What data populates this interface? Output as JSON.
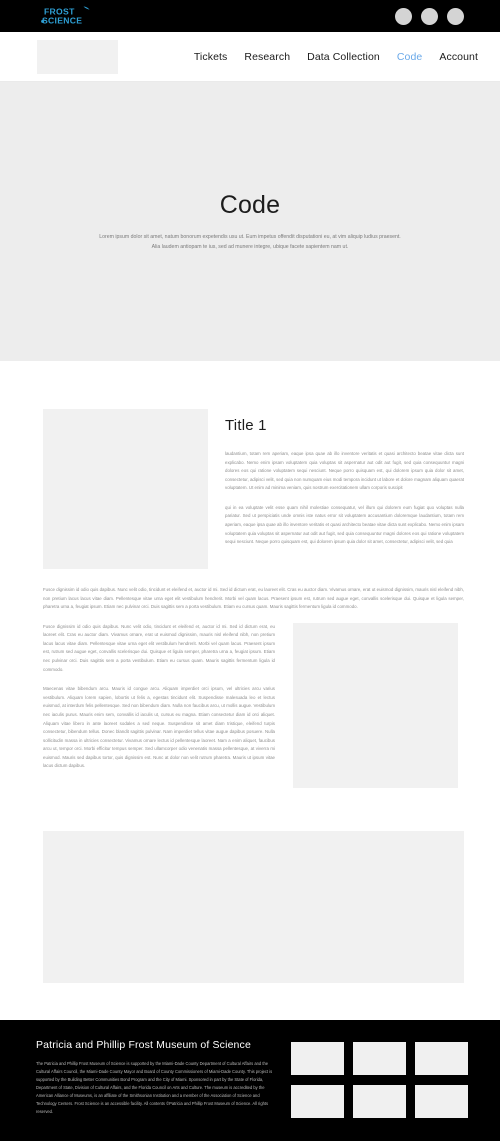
{
  "topbar": {
    "logo_text_line1": "FROST",
    "logo_text_line2": "SCIENCE",
    "logo_accent_color": "#2e9fd4",
    "social_icons": [
      "social-circle-1",
      "social-circle-2",
      "social-circle-3"
    ]
  },
  "nav": {
    "logo_placeholder": "nav-logo-placeholder",
    "links": [
      {
        "label": "Tickets",
        "active": false
      },
      {
        "label": "Research",
        "active": false
      },
      {
        "label": "Data Collection",
        "active": false
      },
      {
        "label": "Code",
        "active": true
      },
      {
        "label": "Account",
        "active": false
      }
    ],
    "active_color": "#6aa9e9"
  },
  "hero": {
    "title": "Code",
    "subtitle": "Lorem ipsum dolor sit amet, natum bonorum expetendis usu ut. Eum impetus offendit disputationi eu, at vim aliquip ludius praesent. Alia laudem antiopam te ius, sed ad munere integre, ubique facete sapientem nam ut.",
    "background": "#ededed"
  },
  "main": {
    "section_title": "Title 1",
    "paragraph_1": "laudantium, totam rem aperiam, eaque ipsa quae ab illo inventore veritatis et quasi architecto beatae vitae dicta sunt explicabo. Nemo enim ipsam voluptatem quia voluptas sit aspernatur aut odit aut fugit, sed quia consequuntur magni dolores eos qui ratione voluptatem sequi nesciunt. Neque porro quisquam est, qui dolorem ipsum quia dolor sit amet, consectetur, adipisci velit, sed quia non numquam eius modi tempora incidunt ut labore et dolore magnam aliquam quaerat voluptatem. Ut enim ad minima veniam, quis nostrum exercitationem ullam corporis suscipit",
    "paragraph_2": "qui in ea voluptate velit esse quam nihil molestiae consequatur, vel illum qui dolorem eum fugiat quo voluptas nulla pariatur. Sed ut perspiciatis unde omnis iste natus error sit voluptatem accusantium doloremque laudantium, totam rem aperiam, eaque ipsa quae ab illo inventore veritatis et quasi architecto beatae vitae dicta sunt explicabo. Nemo enim ipsam voluptatem quia voluptas sit aspernatur aut odit aut fugit, sed quia consequuntur magni dolores eos qui ratione voluptatem sequi nesciunt. Neque porro quisquam est, qui dolorem ipsum quia dolor sit amet, consectetur, adipisci velit, sed quia",
    "paragraph_wide": "Fusce dignissim id odio quis dapibus. Nunc velit odio, tincidunt et eleifend et, auctor id mi. Sed id dictum erat, eu laoreet elit. Cras eu auctor diam. Vivamus ornare, erat ut euismod dignissim, mauris nisl eleifend nibh, non pretium lacus lacus vitae diam. Pellentesque vitae urna eget elit vestibulum hendrerit. Morbi vel quam lacus. Praesent ipsum est, rutrum sed augue eget, convallis scelerisque dui. Quisque et ligula semper, pharetra urna a, feugiat ipsum. Etiam nec pulvinar orci. Duis sagittis sem a porta vestibulum. Etiam eu cursus quam. Mauris sagittis fermentum ligula id commodo.",
    "paragraph_3": "Fusce dignissim id odio quis dapibus. Nunc velit odio, tincidunt et eleifend et, auctor id mi. Sed id dictum erat, eu laoreet elit. Cras eu auctor diam. Vivamus ornare, erat ut euismod dignissim, mauris nisl eleifend nibh, non pretium lacus lacus vitae diam. Pellentesque vitae urna eget elit vestibulum hendrerit. Morbi vel quam lacus. Praesent ipsum est, rutrum sed augue eget, convallis scelerisque dui. Quisque et ligula semper, pharetra urna a, feugiat ipsum. Etiam nec pulvinar orci. Duis sagittis sem a porta vestibulum. Etiam eu cursus quam. Mauris sagittis fermentum ligula id commodo.",
    "paragraph_4": "Maecenas vitae bibendum arcu. Mauris id congue arcu. Aliquam imperdiet orci ipsum, vel ultricies arcu varius vestibulum. Aliquam lorem sapien, lobortis ut felis a, egestas tincidunt elit. Suspendisse malesuada leo et lectus euismod, at interdum felis pellentesque. Sed non bibendum diam. Nulla non faucibus arcu, ut mollis augue. Vestibulum nec iaculis purus. Mauris enim sem, convallis id iaculis ut, cursus eu magna. Etiam consectetur diam id orci aliquet. Aliquam vitae libero in ante laoreet sodales a sed neque. Suspendisse sit amet diam tristique, eleifend turpis consectetur, bibendum tellus. Donec blandit sagittis pulvinar. Nam imperdiet tellus vitae augue dapibus posuere. Nulla sollicitudin massa in ultricies consectetur. Vivamus ornare lectus id pellentesque laoreet. Nam a enim aliquet, faucibus arcu ut, tempor orci. Morbi efficitur tempus semper. Sed ullamcorper odio venenatis massa pellentesque, at viverra mi euismod. Mauris sed dapibus tortor, quis dignissim est. Nunc at dolor non velit rutrum pharetra. Mauris ut ipsum vitae lacus dictum dapibus.",
    "image_placeholders": [
      "image-placeholder-left",
      "image-placeholder-right",
      "image-placeholder-wide"
    ]
  },
  "footer": {
    "title": "Patricia and Phillip Frost Museum of Science",
    "text": "The Patricia and Phillip Frost Museum of Science is supported by the Miami-Dade County Department of Cultural Affairs and the Cultural Affairs Council, the Miami-Dade County Mayor and Board of County Commissioners of Miami-Dade County. This project is supported by the Building Better Communities Bond Program and the City of Miami. Sponsored in part by the State of Florida, Department of State, Division of Cultural Affairs, and the Florida Council on Arts and Culture. The museum is accredited by the American Alliance of Museums, is an affiliate of the Smithsonian Institution and a member of the Association of Science and Technology Centers. Frost Science is an accessible facility. All contents ©Patricia and Phillip Frost Museum of Science. All rights reserved.",
    "sponsor_logos": [
      "sponsor-logo-1",
      "sponsor-logo-2",
      "sponsor-logo-3",
      "sponsor-logo-4",
      "sponsor-logo-5",
      "sponsor-logo-6"
    ],
    "background": "#000000"
  }
}
